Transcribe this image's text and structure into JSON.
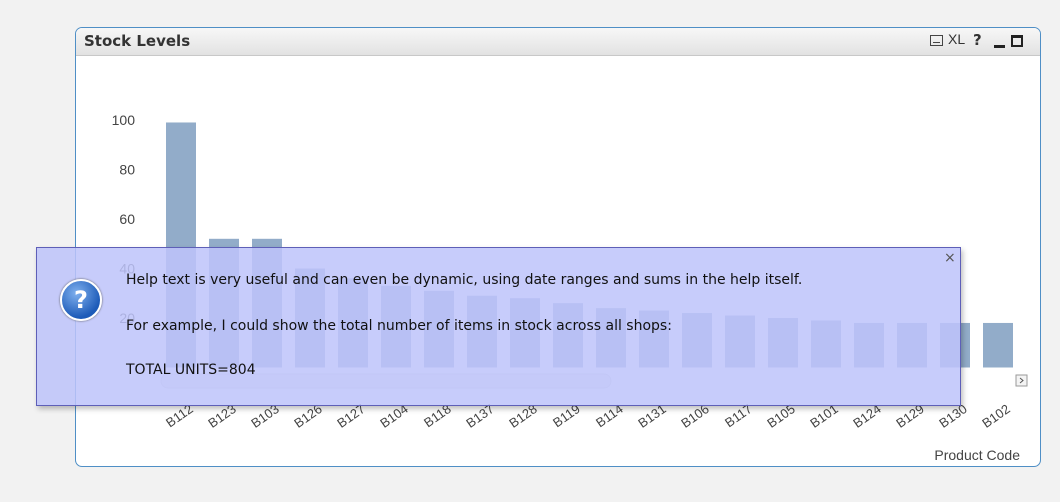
{
  "panel": {
    "title": "Stock Levels",
    "buttons": {
      "xl": "XL",
      "help": "?"
    }
  },
  "chart_data": {
    "type": "bar",
    "title": "",
    "xlabel": "Product Code",
    "ylabel": "",
    "ylim": [
      0,
      110
    ],
    "yticks": [
      20,
      40,
      60,
      80,
      100
    ],
    "categories": [
      "B112",
      "B123",
      "B103",
      "B126",
      "B127",
      "B104",
      "B118",
      "B137",
      "B128",
      "B119",
      "B114",
      "B131",
      "B106",
      "B117",
      "B105",
      "B101",
      "B124",
      "B129",
      "B130",
      "B102"
    ],
    "values": [
      99,
      52,
      52,
      40,
      36,
      33,
      31,
      29,
      28,
      26,
      24,
      23,
      22,
      21,
      20,
      19,
      18,
      18,
      18,
      18
    ],
    "bar_color": "#92acc9",
    "grid": false
  },
  "help": {
    "line1": "Help text is very useful and can even be dynamic, using date ranges and sums in the help itself.",
    "line2": "For example, I could show the total number of items in stock across all shops:",
    "line3": "TOTAL UNITS=804",
    "close": "×",
    "icon": "?"
  }
}
